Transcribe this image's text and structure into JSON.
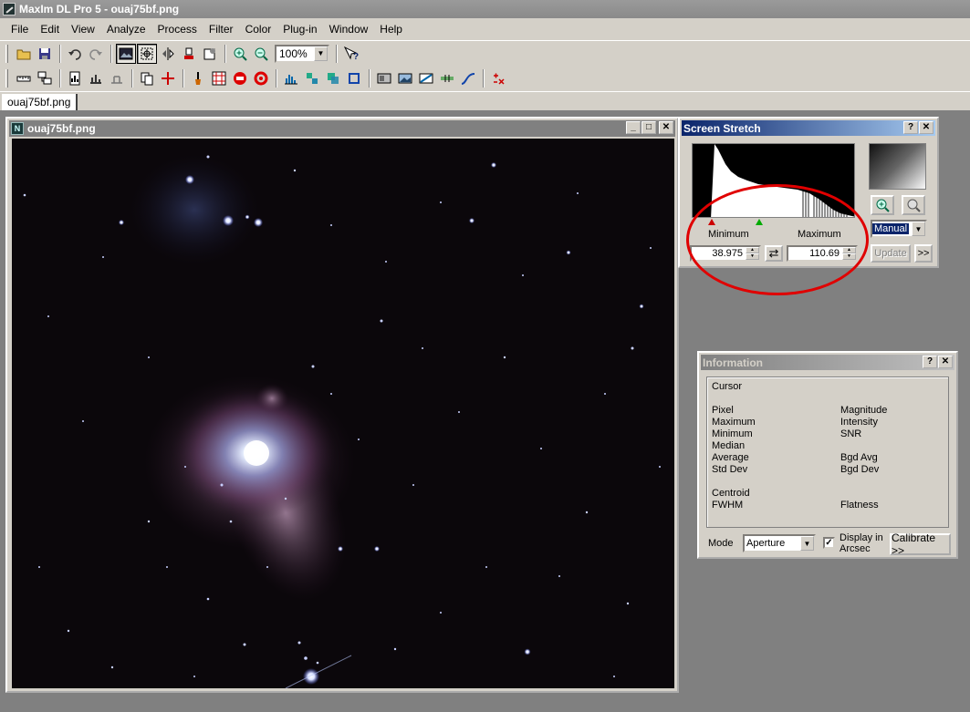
{
  "window": {
    "title": "MaxIm DL Pro 5 - ouaj75bf.png"
  },
  "menu": [
    "File",
    "Edit",
    "View",
    "Analyze",
    "Process",
    "Filter",
    "Color",
    "Plug-in",
    "Window",
    "Help"
  ],
  "toolbar": {
    "zoom_value": "100%"
  },
  "tab": {
    "label": "ouaj75bf.png"
  },
  "image_window": {
    "title": "ouaj75bf.png"
  },
  "screen_stretch": {
    "title": "Screen Stretch",
    "help": "?",
    "close": "✕",
    "minimum_label": "Minimum",
    "maximum_label": "Maximum",
    "minimum_value": "38.975",
    "maximum_value": "110.69",
    "mode_value": "Manual",
    "update_label": "Update",
    "expand_label": ">>",
    "swap_symbol": "⇄",
    "minimum_marker_color": "#cc0000",
    "maximum_marker_color": "#00aa00",
    "annotation_color": "#e00000"
  },
  "information": {
    "title": "Information",
    "help": "?",
    "close": "✕",
    "cursor": "Cursor",
    "left_labels": [
      "Pixel",
      "Maximum",
      "Minimum",
      "Median",
      "Average",
      "Std Dev"
    ],
    "right_labels": [
      "Magnitude",
      "Intensity",
      "SNR",
      "Bgd Avg",
      "Bgd Dev"
    ],
    "centroid": "Centroid",
    "fwhm": "FWHM",
    "flatness": "Flatness",
    "mode_label": "Mode",
    "mode_value": "Aperture",
    "display_in": "Display in",
    "arcsec": "Arcsec",
    "display_arcsec_checked": true,
    "calibrate_label": "Calibrate >>"
  },
  "icons": {
    "toolbar1": [
      "open-icon",
      "save-icon",
      "undo-icon",
      "redo-icon",
      "image-display-icon",
      "crosshair-select-icon",
      "flip-icon",
      "stamp-icon",
      "properties-icon",
      "zoom-in-icon",
      "zoom-out-icon",
      "context-help-icon"
    ],
    "toolbar2": [
      "ruler-icon",
      "stack-icon",
      "document-chart-icon",
      "scale-icon",
      "copy-icon",
      "crosshair-plus-icon",
      "brush-icon",
      "grid-target-icon",
      "stop-red-icon",
      "ring-red-icon",
      "histogram-icon",
      "align-blocks-icon",
      "overlap-squares-icon",
      "frame-square-icon",
      "image-gray-icon",
      "image-blue-icon",
      "image-stretch-icon",
      "bar-marker-icon",
      "curve-icon",
      "plus-minus-x-icon"
    ]
  }
}
